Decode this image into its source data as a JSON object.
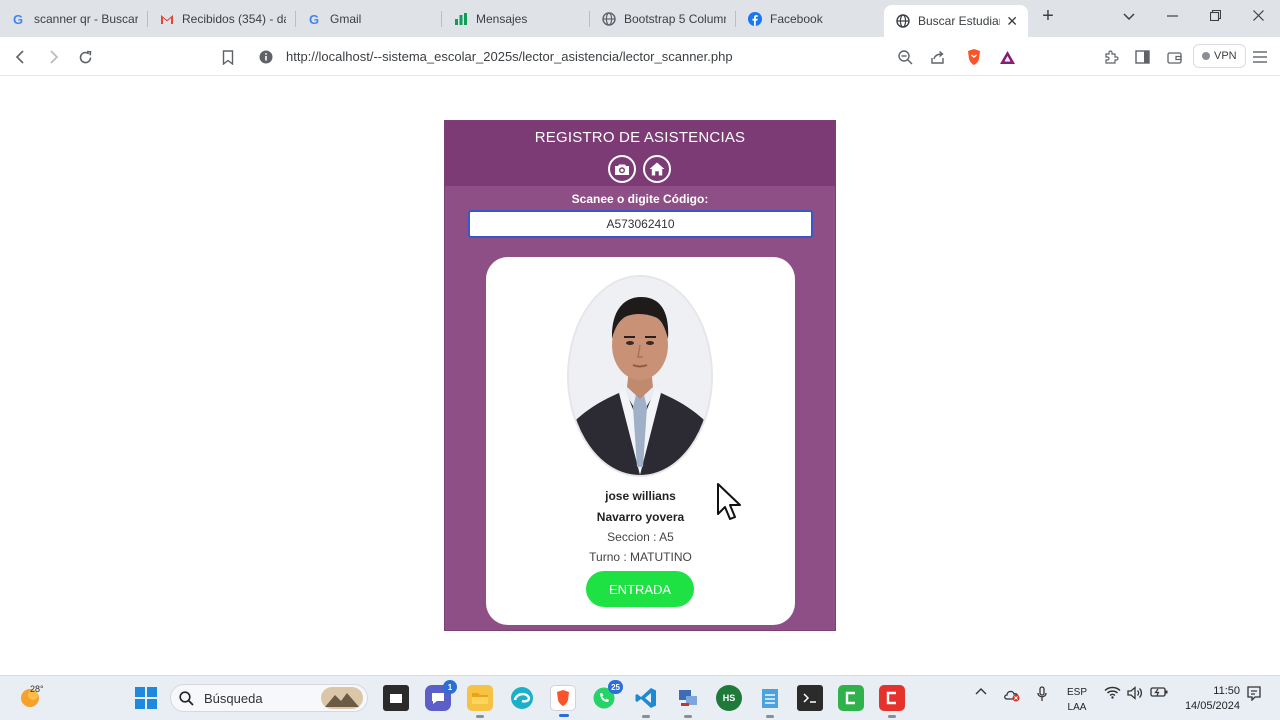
{
  "browser": {
    "tabs": [
      {
        "title": "scanner qr - Buscar c",
        "icon": "google-icon",
        "active": false
      },
      {
        "title": "Recibidos (354) - dan",
        "icon": "gmail-icon",
        "active": false
      },
      {
        "title": "Gmail",
        "icon": "google-icon",
        "active": false
      },
      {
        "title": "Mensajes",
        "icon": "bar-chart-icon",
        "active": false
      },
      {
        "title": "Bootstrap 5 Columna",
        "icon": "globe-icon",
        "active": false
      },
      {
        "title": "Facebook",
        "icon": "facebook-icon",
        "active": false
      },
      {
        "title": "Buscar Estudiant",
        "icon": "globe-icon",
        "active": true
      }
    ],
    "new_tab": "+",
    "url": "http://localhost/--sistema_escolar_2025s/lector_asistencia/lector_scanner.php",
    "vpn_label": "VPN"
  },
  "page": {
    "title": "REGISTRO DE ASISTENCIAS",
    "scan_label": "Scanee o digite Código:",
    "code_value": "A573062410",
    "student": {
      "name_line1": "jose willians",
      "name_line2": "Navarro yovera",
      "seccion": "Seccion : A5",
      "turno": "Turno : MATUTINO"
    },
    "action_button": "ENTRADA",
    "colors": {
      "panel": "#8e4f86",
      "header": "#7c3b74",
      "entrada": "#1ee244",
      "input_border": "#3a57c9"
    }
  },
  "taskbar": {
    "temperature": "28°",
    "search_label": "Búsqueda",
    "teams_badge": "1",
    "whatsapp_badge": "25",
    "language_line1": "ESP",
    "language_line2": "LAA",
    "time": "11:50",
    "date": "14/05/2024"
  }
}
